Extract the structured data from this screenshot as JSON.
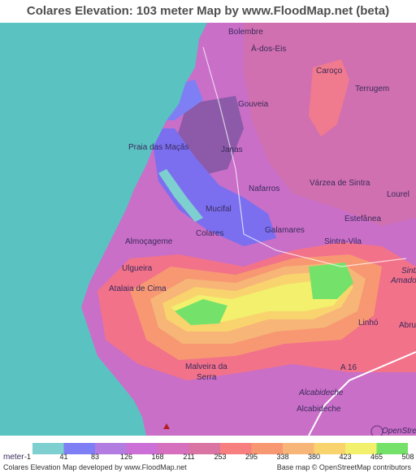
{
  "title": "Colares Elevation: 103 meter Map by www.FloodMap.net (beta)",
  "places": {
    "bolembre": "Bolembre",
    "a_dos_eis": "À-dos-Eis",
    "caroco": "Caroço",
    "terrugem": "Terrugem",
    "gouveia": "Gouveia",
    "praia_das_macas": "Praia das Maçãs",
    "janas": "Janas",
    "nafarros": "Nafarros",
    "varzea_de_sintra": "Várzea de Sintra",
    "lourel": "Lourel",
    "mucifal": "Mucifal",
    "estefanea": "Estefânea",
    "colares": "Colares",
    "galamares": "Galamares",
    "almocageme": "Almoçageme",
    "sintra_vila": "Sintra-Vila",
    "ulgueira": "Ulgueira",
    "sintra_right": "Sintra",
    "amadora_right": "Amado",
    "atalaia_de_cima": "Atalaia de Cima",
    "linho": "Linhó",
    "abru": "Abru",
    "a16": "A 16",
    "malveira_da_serra_1": "Malveira da",
    "malveira_da_serra_2": "Serra",
    "alcabideche_road": "Alcabideche",
    "alcabideche": "Alcabideche"
  },
  "legend": {
    "unit_label": "meter",
    "items": [
      {
        "value": "-1",
        "color": "#7ecfcf"
      },
      {
        "value": "41",
        "color": "#7f7ff5"
      },
      {
        "value": "83",
        "color": "#b27ce0"
      },
      {
        "value": "126",
        "color": "#cc6fd6"
      },
      {
        "value": "168",
        "color": "#d66fbd"
      },
      {
        "value": "211",
        "color": "#d974a3"
      },
      {
        "value": "253",
        "color": "#f77f7f"
      },
      {
        "value": "295",
        "color": "#f79873"
      },
      {
        "value": "338",
        "color": "#f7b577"
      },
      {
        "value": "380",
        "color": "#f8d36e"
      },
      {
        "value": "423",
        "color": "#f3f06d"
      },
      {
        "value": "465",
        "color": "#74e26a"
      },
      {
        "value": "508",
        "color": "#74e26a"
      }
    ]
  },
  "footer": {
    "left": "Colares Elevation Map developed by www.FloodMap.net",
    "right": "Base map © OpenStreetMap contributors"
  },
  "watermark": "OpenStreetMap"
}
